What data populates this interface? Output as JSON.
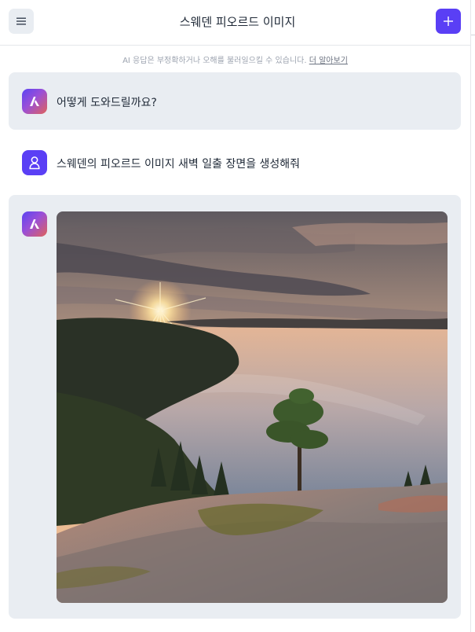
{
  "header": {
    "title": "스웨덴 피오르드 이미지",
    "menu_icon": "hamburger-menu-icon",
    "new_icon": "plus-icon"
  },
  "disclaimer": {
    "text": "AI 응답은 부정확하거나 오해를 불러일으킬 수 있습니다.",
    "link": "더 알아보기"
  },
  "messages": [
    {
      "role": "assistant",
      "text": "어떻게 도와드릴까요?"
    },
    {
      "role": "user",
      "text": "스웨덴의 피오르드 이미지 새벽 일출 장면을 생성해줘"
    },
    {
      "role": "assistant",
      "image": "generated-fjord-sunrise-image"
    }
  ],
  "colors": {
    "accent": "#5a3ff5",
    "card_bg": "#e9edf2",
    "border": "#e5e7eb"
  }
}
